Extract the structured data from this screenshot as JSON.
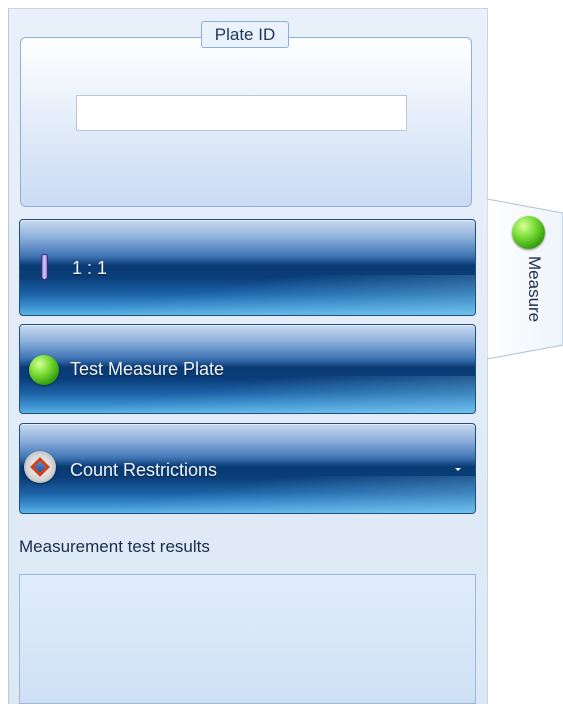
{
  "plate_id": {
    "legend": "Plate ID",
    "value": ""
  },
  "dilution": {
    "label": "1 : 1",
    "icon": "test-tube-icon"
  },
  "test_measure": {
    "label": "Test Measure Plate",
    "icon": "green-status-icon"
  },
  "count_restrictions": {
    "label": "Count Restrictions",
    "icon": "restriction-diamond-icon",
    "caret_icon": "chevron-down-icon"
  },
  "results": {
    "label": "Measurement test results"
  },
  "side_tab": {
    "label": "Measure",
    "icon": "green-status-icon"
  },
  "colors": {
    "bar_dark": "#093a73",
    "bar_light": "#5ab3e3",
    "panel_bg": "#e8f0fa",
    "status_green": "#3aa512"
  }
}
